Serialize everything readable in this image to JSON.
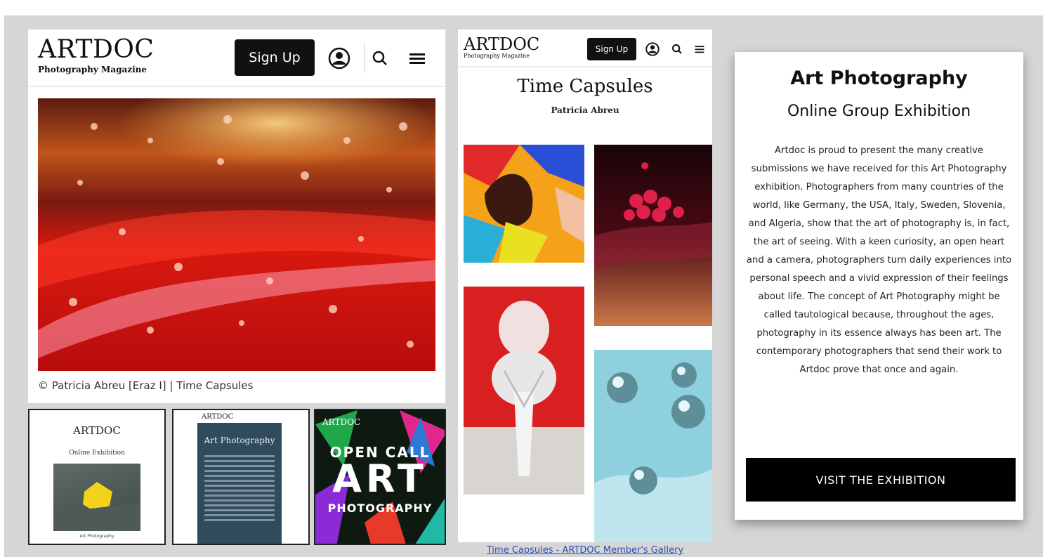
{
  "desktop": {
    "logo": "ARTDOC",
    "logo_subtitle": "Photography Magazine",
    "signup_label": "Sign Up",
    "caption": "© Patricia Abreu [Eraz I] | Time Capsules"
  },
  "thumbnails": {
    "t1": {
      "logo": "ARTDOC",
      "title": "Online Exhibition",
      "bottom": "Art Photography"
    },
    "t2": {
      "logo": "ARTDOC",
      "title": "Art Photography"
    },
    "t3": {
      "logo": "ARTDOC",
      "open_call": "OPEN CALL",
      "art": "ART",
      "photography": "PHOTOGRAPHY"
    }
  },
  "mobile": {
    "logo": "ARTDOC",
    "logo_subtitle": "Photography Magazine",
    "signup_label": "Sign Up",
    "title": "Time Capsules",
    "author": "Patricia Abreu",
    "link": "Time Capsules - ARTDOC Member's Gallery"
  },
  "card": {
    "title": "Art Photography",
    "subtitle": "Online Group Exhibition",
    "body": "Artdoc is proud to present the many creative submissions we have received for this Art Photography exhibition. Photographers from many countries of the world, like Germany, the USA, Italy, Sweden, Slovenia, and Algeria, show that the art of photography is, in fact, the art of seeing. With a keen curiosity, an open heart and a camera, photographers turn daily experiences into personal speech and a vivid expression of their feelings about life. The concept of Art Photography might be called tautological because, throughout the ages, photography in its essence always has been art. The contemporary photographers that send their work to Artdoc prove that once and again.",
    "button": "VISIT THE EXHIBITION"
  },
  "colors": {
    "background": "#d6d6d6",
    "button": "#000000",
    "link": "#2a4fb3"
  },
  "icons": [
    "user-icon",
    "search-icon",
    "menu-icon"
  ]
}
